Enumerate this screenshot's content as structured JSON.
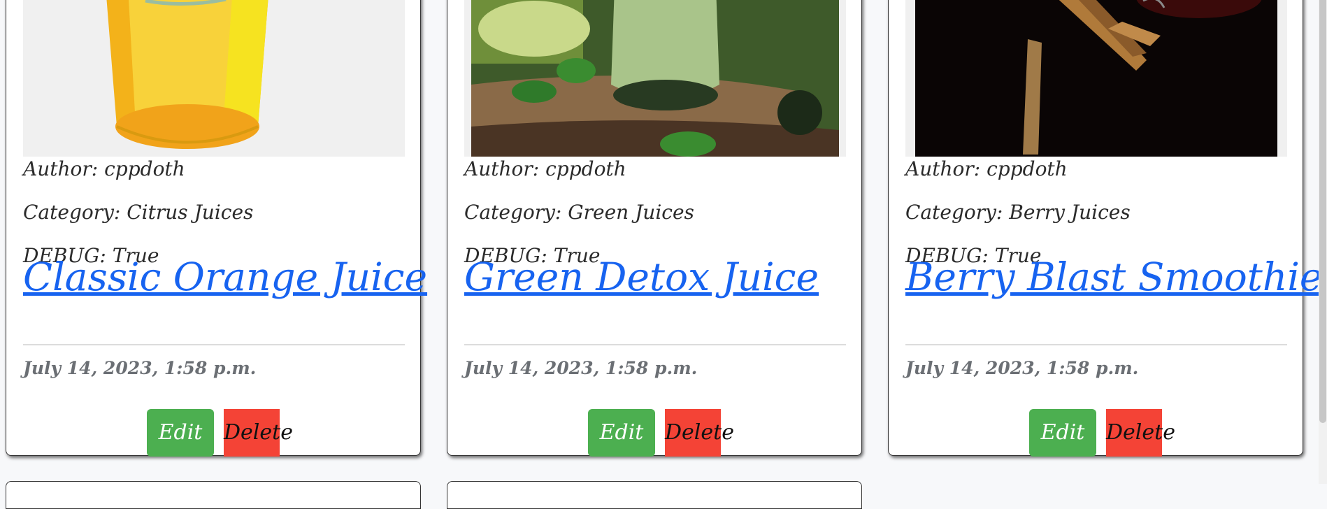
{
  "cards": [
    {
      "author_label": "Author: cppdoth",
      "category_label": "Category: Citrus Juices",
      "debug_label": "DEBUG: True",
      "title": "Classic Orange Juice",
      "date": "July 14, 2023, 1:58 p.m.",
      "edit_label": "Edit",
      "delete_label": "Delete",
      "image_alt": "Glass of orange juice"
    },
    {
      "author_label": "Author: cppdoth",
      "category_label": "Category: Green Juices",
      "debug_label": "DEBUG: True",
      "title": "Green Detox Juice",
      "date": "July 14, 2023, 1:58 p.m.",
      "edit_label": "Edit",
      "delete_label": "Delete",
      "image_alt": "Green smoothie on a wooden board"
    },
    {
      "author_label": "Author: cppdoth",
      "category_label": "Category: Berry Juices",
      "debug_label": "DEBUG: True",
      "title": "Berry Blast Smoothie",
      "date": "July 14, 2023, 1:58 p.m.",
      "edit_label": "Edit",
      "delete_label": "Delete",
      "image_alt": "Cinnamon sticks on dark background"
    }
  ],
  "colors": {
    "link": "#1763f0",
    "edit_button": "#4caf50",
    "delete_button": "#f44336",
    "meta_text": "#2b2b2b",
    "date_text": "#6b6f74"
  }
}
